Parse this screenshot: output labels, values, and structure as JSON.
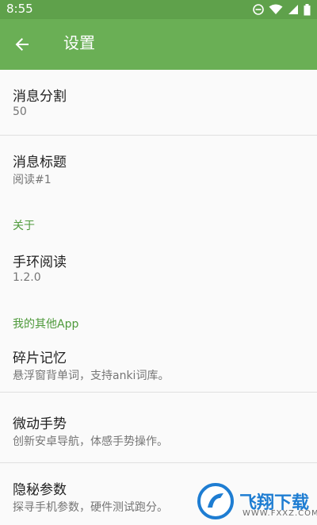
{
  "status_bar": {
    "time": "8:55",
    "icons": [
      "do-not-disturb-icon",
      "wifi-icon",
      "signal-icon",
      "battery-icon"
    ]
  },
  "app_bar": {
    "title": "设置",
    "back_icon": "arrow-back-icon",
    "color": "#6aaf55"
  },
  "prefs": {
    "split": {
      "title": "消息分割",
      "summary": "50"
    },
    "msg_title": {
      "title": "消息标题",
      "summary": "阅读#1"
    },
    "about_header": "关于",
    "band": {
      "title": "手环阅读",
      "summary": "1.2.0"
    },
    "other_apps_header": "我的其他App",
    "memory": {
      "title": "碎片记忆",
      "summary": "悬浮窗背单词，支持anki词库。"
    },
    "gesture": {
      "title": "微动手势",
      "summary": "创新安卓导航，体感手势操作。"
    },
    "params": {
      "title": "隐秘参数",
      "summary": "探寻手机参数，硬件测试跑分。"
    }
  },
  "watermark": {
    "brand": "飞翔下载",
    "url": "WWW.FXXZ.COM"
  },
  "colors": {
    "accent": "#4e9a3b",
    "statusbar": "#5fa14b",
    "brand": "#1e7dd2"
  }
}
